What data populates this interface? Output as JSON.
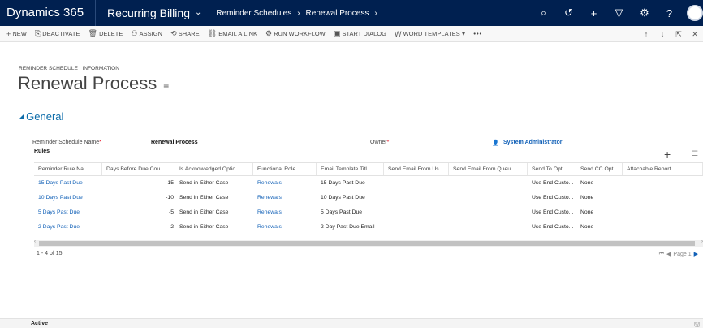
{
  "nav": {
    "brand": "Dynamics 365",
    "area": "Recurring Billing",
    "breadcrumbs": [
      "Reminder Schedules",
      "Renewal Process"
    ],
    "icons": [
      "search-icon",
      "history-icon",
      "add-icon",
      "filter-icon",
      "settings-icon",
      "help-icon",
      "avatar"
    ]
  },
  "commands": [
    {
      "name": "new",
      "icon": "+",
      "label": "NEW"
    },
    {
      "name": "deactivate",
      "icon": "⎘",
      "label": "DEACTIVATE"
    },
    {
      "name": "delete",
      "icon": "🗑",
      "label": "DELETE"
    },
    {
      "name": "assign",
      "icon": "⚇",
      "label": "ASSIGN"
    },
    {
      "name": "share",
      "icon": "⟲",
      "label": "SHARE"
    },
    {
      "name": "email-link",
      "icon": "⛓",
      "label": "EMAIL A LINK"
    },
    {
      "name": "run-workflow",
      "icon": "⚙",
      "label": "RUN WORKFLOW"
    },
    {
      "name": "start-dialog",
      "icon": "▣",
      "label": "START DIALOG"
    },
    {
      "name": "word-templates",
      "icon": "W",
      "label": "WORD TEMPLATES"
    }
  ],
  "header": {
    "entity_type": "REMINDER SCHEDULE : INFORMATION",
    "title": "Renewal Process"
  },
  "section": {
    "title": "General"
  },
  "fields": {
    "name_label": "Reminder Schedule Name",
    "name_value": "Renewal Process",
    "owner_label": "Owner",
    "owner_value": "System Administrator"
  },
  "rules": {
    "title": "Rules",
    "columns": [
      "Reminder Rule Na...",
      "Days Before Due Cou...",
      "Is Acknowledged Optio...",
      "Functional Role",
      "Email Template Titl...",
      "Send Email From Us...",
      "Send Email From Queu...",
      "Send To Opti...",
      "Send CC Opt...",
      "Attachable Report"
    ],
    "rows": [
      {
        "name": "15 Days Past Due",
        "days": "-15",
        "ack": "Send in Either Case",
        "role": "Renewals",
        "template": "15 Days Past Due",
        "send_to": "Use End Custo...",
        "cc": "None"
      },
      {
        "name": "10 Days Past Due",
        "days": "-10",
        "ack": "Send in Either Case",
        "role": "Renewals",
        "template": "10 Days Past Due",
        "send_to": "Use End Custo...",
        "cc": "None"
      },
      {
        "name": "5 Days Past Due",
        "days": "-5",
        "ack": "Send in Either Case",
        "role": "Renewals",
        "template": "5 Days Past Due",
        "send_to": "Use End Custo...",
        "cc": "None"
      },
      {
        "name": "2 Days Past Due",
        "days": "-2",
        "ack": "Send in Either Case",
        "role": "Renewals",
        "template": "2 Day Past Due Email",
        "send_to": "Use End Custo...",
        "cc": "None"
      }
    ],
    "record_count": "1 - 4 of 15",
    "page_label": "Page 1"
  },
  "status": {
    "text": "Active"
  }
}
